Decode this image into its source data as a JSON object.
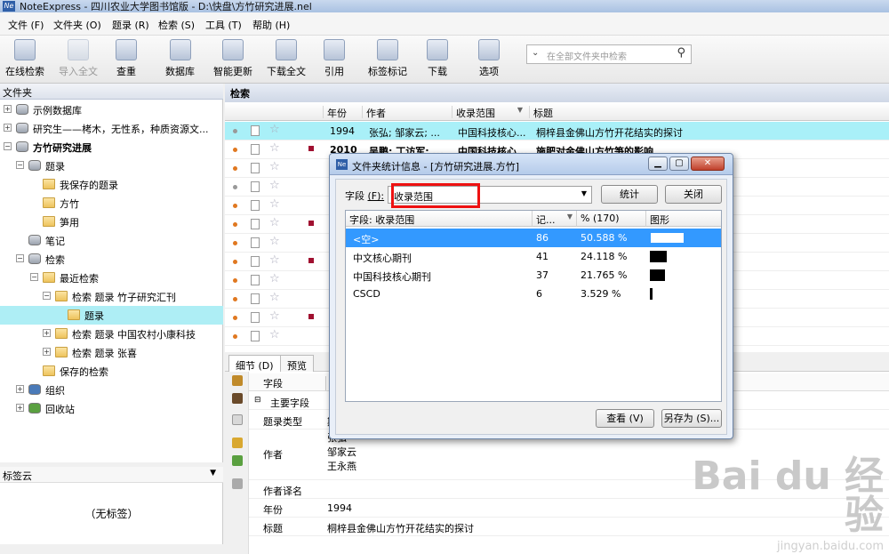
{
  "window": {
    "title": "NoteExpress - 四川农业大学图书馆版 - D:\\快盘\\方竹研究进展.nel",
    "icon_text": "Ne"
  },
  "menu": [
    "文件 (F)",
    "文件夹 (O)",
    "题录 (R)",
    "检索 (S)",
    "工具 (T)",
    "帮助 (H)"
  ],
  "toolbar": [
    {
      "label": "在线检索",
      "icon": "online-search-icon",
      "disabled": false
    },
    {
      "label": "导入全文",
      "icon": "import-fulltext-icon",
      "disabled": true
    },
    {
      "label": "查重",
      "icon": "duplicate-check-icon",
      "disabled": false
    },
    {
      "label": "数据库",
      "icon": "database-icon",
      "disabled": false
    },
    {
      "label": "智能更新",
      "icon": "smart-update-icon",
      "disabled": false
    },
    {
      "label": "下载全文",
      "icon": "download-fulltext-icon",
      "disabled": false
    },
    {
      "label": "引用",
      "icon": "cite-icon",
      "disabled": false
    },
    {
      "label": "标签标记",
      "icon": "tag-icon",
      "disabled": false
    },
    {
      "label": "下载",
      "icon": "download-icon",
      "disabled": false
    },
    {
      "label": "选项",
      "icon": "options-icon",
      "disabled": false
    }
  ],
  "search": {
    "placeholder": "在全部文件夹中检索"
  },
  "left": {
    "header": "文件夹",
    "tree": [
      {
        "label": "示例数据库",
        "type": "db",
        "exp": "+",
        "bold": false
      },
      {
        "label": "研究生——栲木，无性系，种质资源文...",
        "type": "db",
        "exp": "+",
        "bold": false
      },
      {
        "label": "方竹研究进展",
        "type": "db",
        "exp": "−",
        "bold": true
      },
      {
        "label": "题录",
        "type": "list",
        "exp": "−",
        "bold": false
      },
      {
        "label": "我保存的题录",
        "type": "folder",
        "exp": "",
        "bold": false
      },
      {
        "label": "方竹",
        "type": "folder",
        "exp": "",
        "bold": false
      },
      {
        "label": "笋用",
        "type": "folder",
        "exp": "",
        "bold": false
      },
      {
        "label": "笔记",
        "type": "note",
        "exp": "",
        "bold": false
      },
      {
        "label": "检索",
        "type": "search",
        "exp": "−",
        "bold": false
      },
      {
        "label": "最近检索",
        "type": "folder",
        "exp": "−",
        "bold": false
      },
      {
        "label": "检索 题录 竹子研究汇刊",
        "type": "folder",
        "exp": "−",
        "bold": false
      },
      {
        "label": "题录",
        "type": "folder",
        "exp": "",
        "bold": false,
        "selected": true
      },
      {
        "label": "检索 题录 中国农村小康科技",
        "type": "folder",
        "exp": "+",
        "bold": false
      },
      {
        "label": "检索 题录 张喜",
        "type": "folder",
        "exp": "+",
        "bold": false
      },
      {
        "label": "保存的检索",
        "type": "folder",
        "exp": "",
        "bold": false
      },
      {
        "label": "组织",
        "type": "org",
        "exp": "+",
        "bold": false
      },
      {
        "label": "回收站",
        "type": "trash",
        "exp": "+",
        "bold": false
      }
    ],
    "tagcloud_title": "标签云",
    "tagcloud_empty": "（无标签）"
  },
  "main": {
    "header": "检索",
    "columns": [
      "年份",
      "作者",
      "收录范围",
      "标题"
    ],
    "rows": [
      {
        "year": "1994",
        "author": "张弘; 邹家云; ...",
        "scope": "中国科技核心...",
        "title": "桐梓县金佛山方竹开花结实的探讨",
        "bold": false,
        "selected": true,
        "dot": "#999999",
        "flag": false
      },
      {
        "year": "2010",
        "author": "吴鹏; 丁访军; ...",
        "scope": "中国科技核心...",
        "title": "施肥对金佛山方竹笋的影响",
        "bold": true,
        "selected": false,
        "dot": "#e07820",
        "flag": true
      },
      {
        "year": "",
        "author": "",
        "scope": "",
        "title": "",
        "bold": false,
        "selected": false,
        "dot": "#e07820",
        "flag": false
      },
      {
        "year": "",
        "author": "",
        "scope": "",
        "title": "",
        "bold": false,
        "selected": false,
        "dot": "#999999",
        "flag": false
      },
      {
        "year": "",
        "author": "",
        "scope": "",
        "title": "响",
        "bold": false,
        "selected": false,
        "dot": "#e07820",
        "flag": false
      },
      {
        "year": "",
        "author": "",
        "scope": "",
        "title": "",
        "bold": false,
        "selected": false,
        "dot": "#e07820",
        "flag": true
      },
      {
        "year": "",
        "author": "",
        "scope": "",
        "title": "",
        "bold": false,
        "selected": false,
        "dot": "#e07820",
        "flag": false
      },
      {
        "year": "",
        "author": "",
        "scope": "",
        "title": "",
        "bold": false,
        "selected": false,
        "dot": "#e07820",
        "flag": true
      },
      {
        "year": "",
        "author": "",
        "scope": "",
        "title": "",
        "bold": false,
        "selected": false,
        "dot": "#e07820",
        "flag": false
      },
      {
        "year": "",
        "author": "",
        "scope": "",
        "title": "",
        "bold": false,
        "selected": false,
        "dot": "#e07820",
        "flag": false
      },
      {
        "year": "",
        "author": "",
        "scope": "",
        "title": "",
        "bold": false,
        "selected": false,
        "dot": "#e07820",
        "flag": true
      },
      {
        "year": "",
        "author": "",
        "scope": "",
        "title": "",
        "bold": false,
        "selected": false,
        "dot": "#e07820",
        "flag": false
      }
    ],
    "tabs": [
      "细节 (D)",
      "预览"
    ],
    "detail_col_field": "字段",
    "detail_col_value": "内",
    "detail_section": "主要字段",
    "detail": [
      {
        "k": "题录类型",
        "v": "期"
      },
      {
        "k": "作者",
        "v": "张弘\n邹家云\n王永燕"
      },
      {
        "k": "作者译名",
        "v": ""
      },
      {
        "k": "年份",
        "v": "1994"
      },
      {
        "k": "标题",
        "v": "桐梓县金佛山方竹开花结实的探讨"
      }
    ]
  },
  "dialog": {
    "title": "文件夹统计信息 - [方竹研究进展.方竹]",
    "icon_text": "Ne",
    "field_label": "字段",
    "field_hotkey": "(F):",
    "field_value": "收录范围",
    "btn_stats": "统计",
    "btn_close": "关闭",
    "cols": [
      "字段: 收录范围",
      "记...",
      "% (170)",
      "图形"
    ],
    "rows": [
      {
        "name": "<空>",
        "count": "86",
        "pct": "50.588 %",
        "frac": 0.50588,
        "selected": true
      },
      {
        "name": "中文核心期刊",
        "count": "41",
        "pct": "24.118 %",
        "frac": 0.24118,
        "selected": false
      },
      {
        "name": "中国科技核心期刊",
        "count": "37",
        "pct": "21.765 %",
        "frac": 0.21765,
        "selected": false
      },
      {
        "name": "CSCD",
        "count": "6",
        "pct": "3.529 %",
        "frac": 0.03529,
        "selected": false
      }
    ],
    "btn_view": "查看 (V)",
    "btn_saveas": "另存为 (S)..."
  },
  "watermark": {
    "main": "Bai du 经验",
    "sub": "jingyan.baidu.com"
  }
}
